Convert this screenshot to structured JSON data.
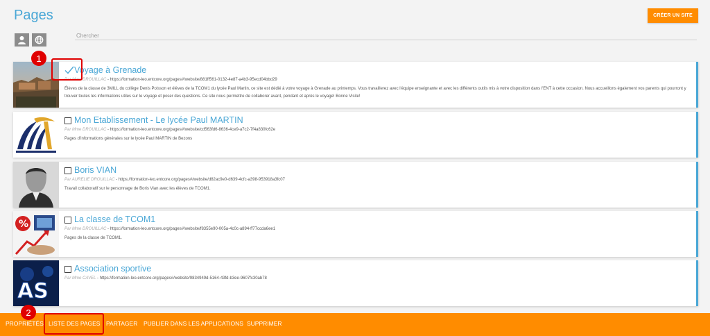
{
  "header": {
    "title": "Pages",
    "create_button": "CRÉER UN SITE"
  },
  "filters": [
    {
      "icon": "user-icon"
    },
    {
      "icon": "globe-icon"
    }
  ],
  "search": {
    "placeholder": "Chercher"
  },
  "sites": [
    {
      "title": "Voyage à Grenade",
      "owner": "Par Mme DROUILLAC",
      "url": "https://formation-leo.entcore.org/pages#/website/881ff561-0132-4e87-a4b3-95ecd04bbd29",
      "description": "Élèves de la classe de 3MILL du collège Denis Poisson et élèves de la TCOM1 du lycée Paul Martin, ce site est dédié à votre voyage à Grenade au printemps. Vous travaillerez avec l'équipe enseignante et avec les différents outils mis à votre disposition dans l'ENT à cette occasion. Nous accueillons également vos parents qui pourront y trouver toutes les informations utiles sur le voyage et poser des questions. Ce site nous permettre de collaborer avant, pendant et après le voyage! Bonne Visite!",
      "selected": true
    },
    {
      "title": "Mon Etablissement - Le lycée Paul MARTIN",
      "owner": "Par Mme DROUILLAC",
      "url": "https://formation-leo.entcore.org/pages#/website/cd563fd6-8636-4ce9-a7c2-7f4a830fc62e",
      "description": "Pages d'informations générales sur le lycée Paul MARTIN de Bezons",
      "selected": false
    },
    {
      "title": "Boris VIAN",
      "owner": "Par AURELIE DROUILLAC",
      "url": "https://formation-leo.entcore.org/pages#/website/d82ac9e0-d639-4cfc-a398-953918a3fc07",
      "description": "Travail collaboratif sur le personnage de Boris Vian avec les élèves de TCOM1.",
      "selected": false
    },
    {
      "title": "La classe de TCOM1",
      "owner": "Par Mme DROUILLAC",
      "url": "https://formation-leo.entcore.org/pages#/website/f8355e90-005a-4c0c-a894-ff77ccda6ee1",
      "description": "Pages de la classe de TCOM1.",
      "selected": false
    },
    {
      "title": "Association sportive",
      "owner": "Par Mme CAVEL",
      "url": "https://formation-leo.entcore.org/pages#/website/9834949d-5164-43fd-b3ee-9607fc30ab78",
      "description": "",
      "selected": false
    }
  ],
  "annotations": [
    "1",
    "2"
  ],
  "bottom_bar": {
    "properties": "PROPRIÉTÉS",
    "list_pages": "LISTE DES PAGES",
    "share": "PARTAGER",
    "publish": "PUBLIER DANS LES APPLICATIONS",
    "delete": "SUPPRIMER"
  },
  "colors": {
    "accent": "#4aa7d6",
    "action_bar": "#ff8c00",
    "highlight": "#e00000"
  }
}
